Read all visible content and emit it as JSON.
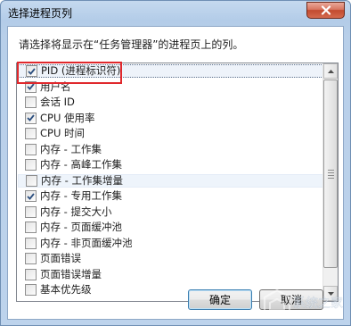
{
  "window": {
    "title": "选择进程页列"
  },
  "instruction": "请选择将显示在“任务管理器”的进程页上的列。",
  "columns": [
    {
      "label": "PID (进程标识符)",
      "checked": true
    },
    {
      "label": "用户名",
      "checked": true
    },
    {
      "label": "会话 ID",
      "checked": false
    },
    {
      "label": "CPU 使用率",
      "checked": true
    },
    {
      "label": "CPU 时间",
      "checked": false
    },
    {
      "label": "内存 - 工作集",
      "checked": false
    },
    {
      "label": "内存 - 高峰工作集",
      "checked": false
    },
    {
      "label": "内存 - 工作集增量",
      "checked": false
    },
    {
      "label": "内存 - 专用工作集",
      "checked": true
    },
    {
      "label": "内存 - 提交大小",
      "checked": false
    },
    {
      "label": "内存 - 页面缓冲池",
      "checked": false
    },
    {
      "label": "内存 - 非页面缓冲池",
      "checked": false
    },
    {
      "label": "页面错误",
      "checked": false
    },
    {
      "label": "页面错误增量",
      "checked": false
    },
    {
      "label": "基本优先级",
      "checked": false
    }
  ],
  "buttons": {
    "ok": "确定",
    "cancel": "取消"
  },
  "watermark": {
    "text": "系统之家"
  },
  "colors": {
    "highlight": "#e0282c",
    "close_button": "#c24a2f",
    "title_bar": "#b3cce8"
  }
}
